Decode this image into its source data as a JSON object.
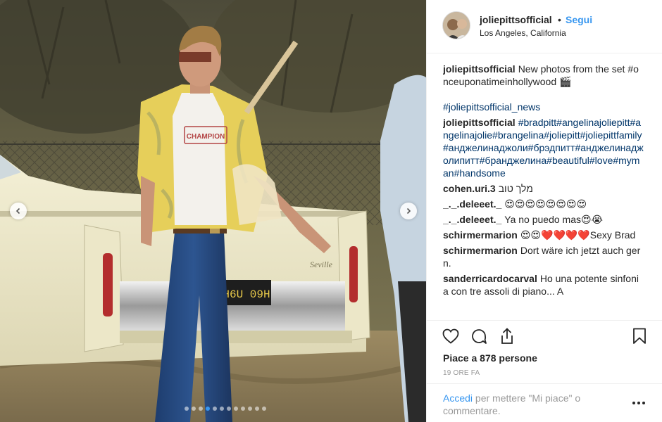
{
  "post": {
    "username": "joliepittsofficial",
    "follow_label": "Segui",
    "separator": "•",
    "location": "Los Angeles, California"
  },
  "photo": {
    "plate_text": "H6U 09H",
    "shirt_text": "CHAMPION",
    "car_badge": "Seville",
    "carousel_dot_count": 12,
    "carousel_active_index": 3
  },
  "comments": [
    {
      "author": "joliepittsofficial",
      "text": "New photos from the set #onceuponatimeinhollywood 🎬"
    },
    {
      "author": "",
      "text": "#joliepittsofficial_news",
      "link": true
    },
    {
      "author": "joliepittsofficial",
      "text": "#bradpitt#angelinajoliepitt#angelinajolie#brangelina#joliepitt#joliepittfamily#анджелинаджоли#брэдпитт#анджелинаджолипитт#бранджелина#beautiful#love#myman#handsome",
      "link": true
    },
    {
      "author": "cohen.uri.3",
      "text": "מלך טוב"
    },
    {
      "author": "_._.deleeet._",
      "text": "😍😍😍😍😍😍😍😍"
    },
    {
      "author": "_._.deleeet._",
      "text": "Ya no puedo mas😍😭"
    },
    {
      "author": "schirmermarion",
      "text": "😍😍❤️❤️❤️❤️Sexy Brad"
    },
    {
      "author": "schirmermarion",
      "text": "Dort wäre ich jetzt auch gern."
    },
    {
      "author": "sanderricardocarval",
      "text": "Ho una potente sinfonia con tre assoli di piano... A"
    }
  ],
  "actions": {
    "like_icon": "heart-icon",
    "comment_icon": "comment-bubble-icon",
    "share_icon": "share-icon",
    "save_icon": "bookmark-icon",
    "likes_label": "Piace a 878 persone",
    "time_label": "19 ORE FA"
  },
  "footer": {
    "login_link": "Accedi",
    "login_rest": " per mettere \"Mi piace\" o commentare.",
    "more_icon": "more-options-icon"
  },
  "colors": {
    "accent": "#3897f0",
    "hashtag": "#003569",
    "muted": "#999999",
    "border": "#efefef"
  }
}
